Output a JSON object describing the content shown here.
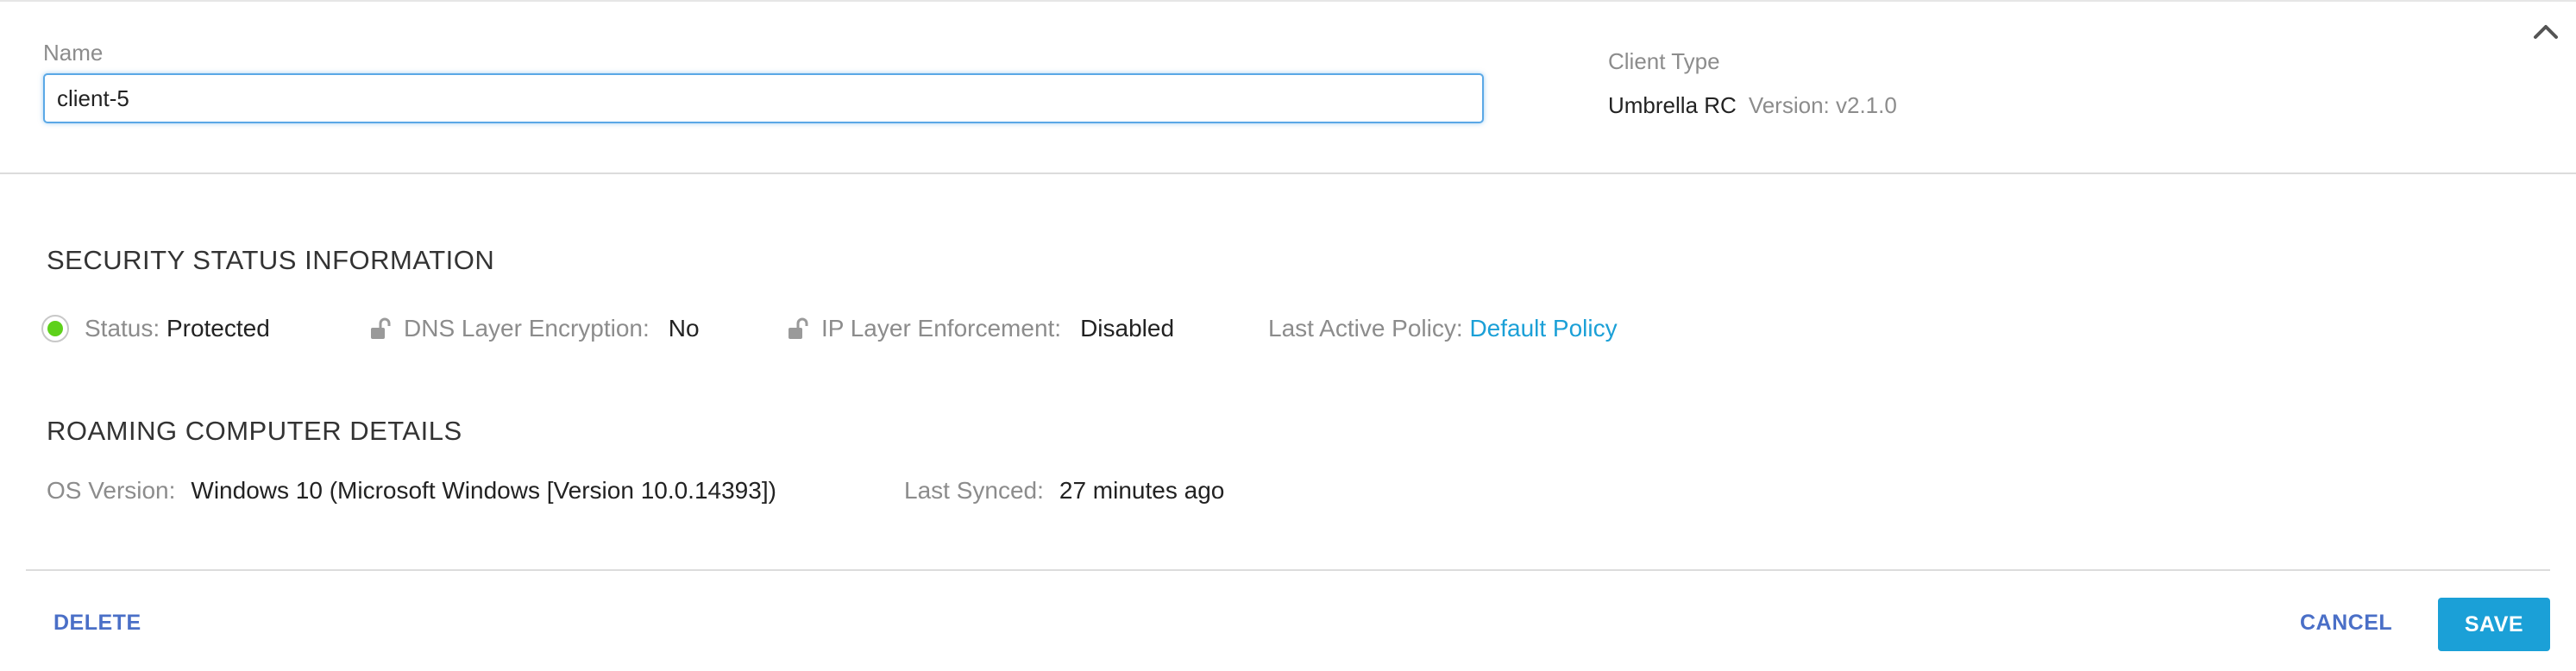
{
  "header": {
    "name_label": "Name",
    "name_value": "client-5",
    "client_type_label": "Client Type",
    "client_type_value": "Umbrella RC",
    "client_version": "Version: v2.1.0",
    "collapse_icon": "chevron-up-icon"
  },
  "security": {
    "title": "SECURITY STATUS INFORMATION",
    "status_label": "Status:",
    "status_value": "Protected",
    "status_color": "#5ed11a",
    "dns_label": "DNS Layer Encryption:",
    "dns_value": "No",
    "ip_label": "IP Layer Enforcement:",
    "ip_value": "Disabled",
    "policy_label": "Last Active Policy:",
    "policy_value": "Default Policy",
    "lock_icon": "unlocked-lock-icon"
  },
  "details": {
    "title": "ROAMING COMPUTER DETAILS",
    "os_label": "OS Version:",
    "os_value": "Windows 10 (Microsoft Windows [Version 10.0.14393])",
    "synced_label": "Last Synced:",
    "synced_value": "27 minutes ago"
  },
  "footer": {
    "delete_label": "DELETE",
    "cancel_label": "CANCEL",
    "save_label": "SAVE"
  },
  "colors": {
    "accent": "#1ba0d7",
    "link": "#1ba0d7",
    "text_button": "#4a6fc7",
    "focus_border": "#5aa8e6"
  }
}
